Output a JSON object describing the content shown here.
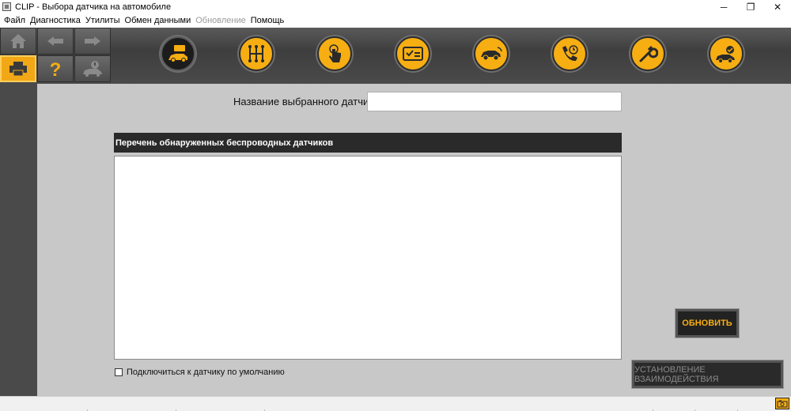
{
  "window": {
    "title": "CLIP - Выбора датчика на автомобиле",
    "minimize": "─",
    "restore": "❐",
    "close": "✕"
  },
  "menu": [
    {
      "label": "Файл",
      "enabled": true
    },
    {
      "label": "Диагностика",
      "enabled": true
    },
    {
      "label": "Утилиты",
      "enabled": true
    },
    {
      "label": "Обмен данными",
      "enabled": true
    },
    {
      "label": "Обновление",
      "enabled": false
    },
    {
      "label": "Помощь",
      "enabled": true
    }
  ],
  "toolbar": {
    "buttons": [
      "home-icon",
      "back-arrow-icon",
      "forward-arrow-icon",
      "print-icon",
      "help-question-icon",
      "car-warning-icon"
    ],
    "nav_icons": [
      "sensor-car-icon",
      "gearbox-icon",
      "touch-hand-icon",
      "id-card-icon",
      "car-scan-icon",
      "phone-clock-icon",
      "wrench-icon",
      "car-check-icon"
    ],
    "active_nav_index": 0
  },
  "main": {
    "sensor_name_label": "Название выбранного датчика",
    "sensor_name_value": "",
    "list_header": "Перечень обнаруженных беспроводных датчиков",
    "list_items": [],
    "default_checkbox_label": "Подключиться к датчику по умолчанию",
    "default_checkbox_checked": false,
    "refresh_button": "ОБНОВИТЬ",
    "connect_button": "УСТАНОВЛЕНИЕ ВЗАИМОДЕЙСТВИЯ"
  },
  "colors": {
    "accent": "#f6ae13",
    "toolbar_bg": "#4a4a4a",
    "main_bg": "#c8c8c8",
    "header_bg": "#2a2a2a"
  }
}
